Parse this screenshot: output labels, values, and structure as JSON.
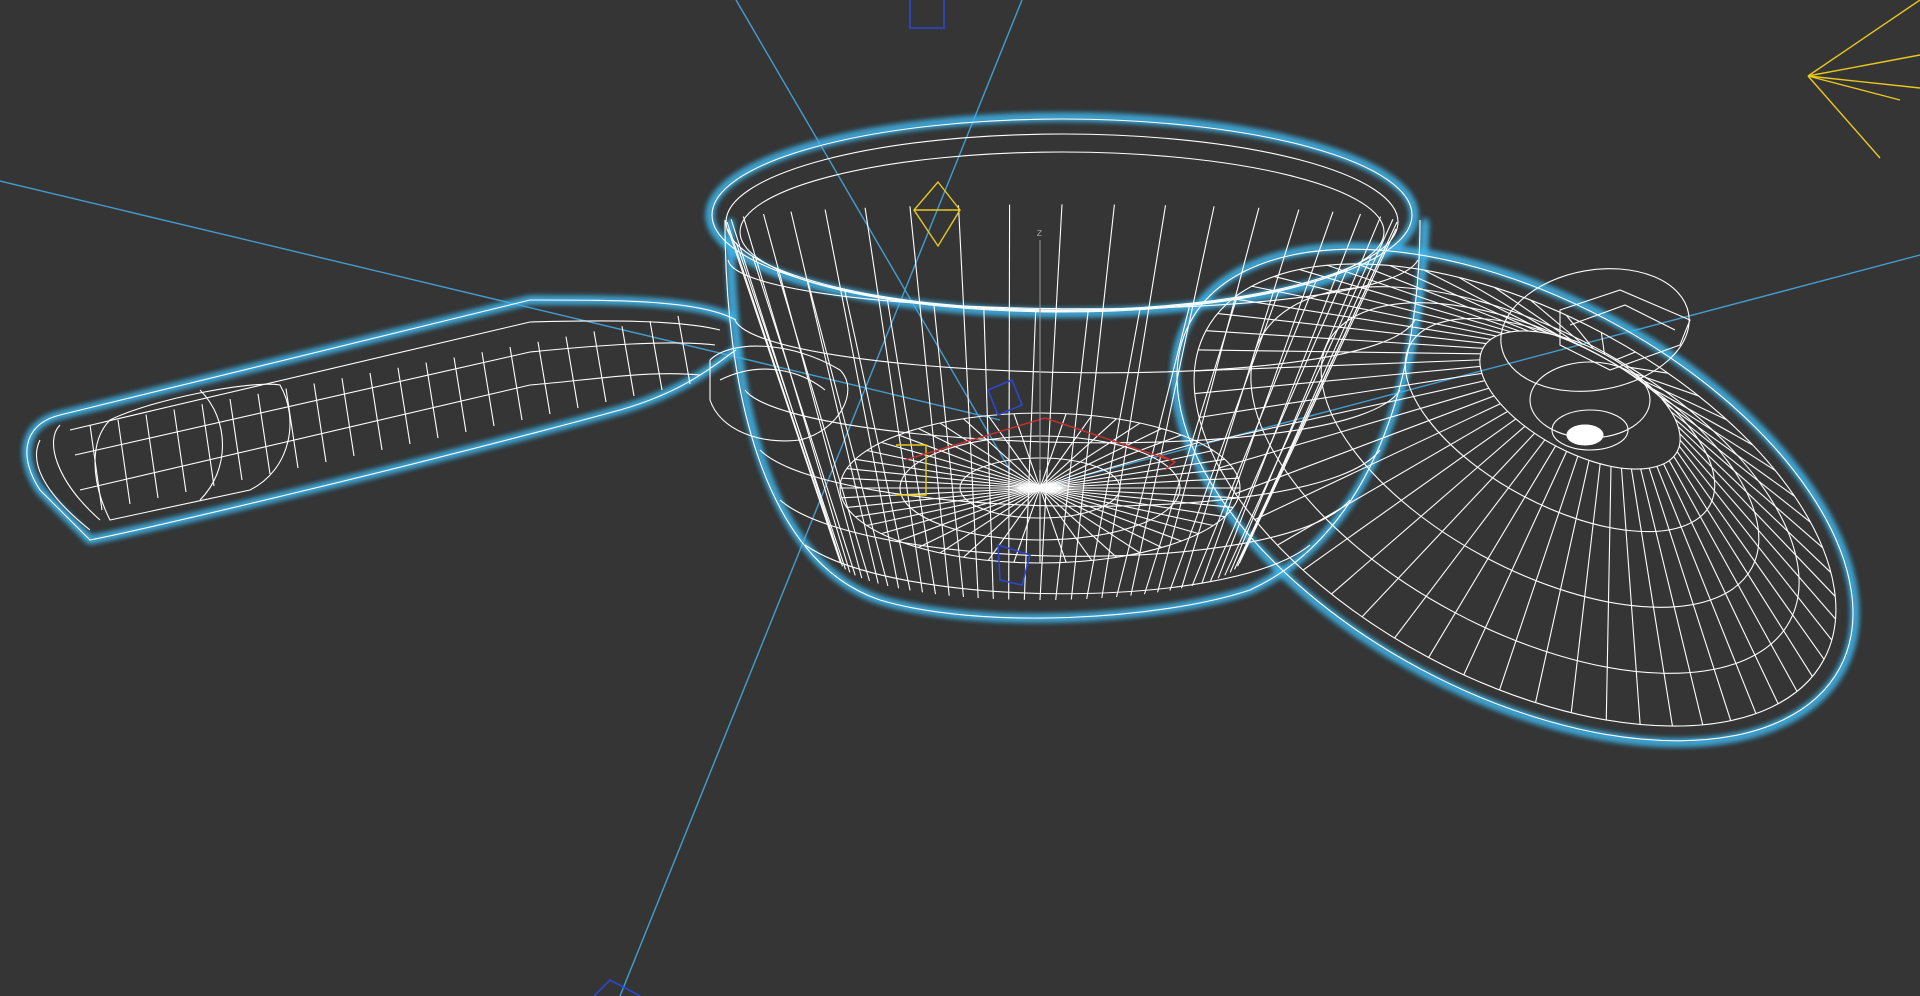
{
  "viewport": {
    "mode": "wireframe",
    "background_color": "#353535",
    "wire_color": "#ffffff",
    "selection_glow_color": "#3fb6ec",
    "camera_guide_color": "#46a8e0",
    "light_color": "#e8c81e",
    "helper_color": "#2040c8",
    "pivot_color": "#d03030",
    "z_axis_label": "z",
    "selected_objects": [
      "saucepan",
      "lid"
    ]
  }
}
